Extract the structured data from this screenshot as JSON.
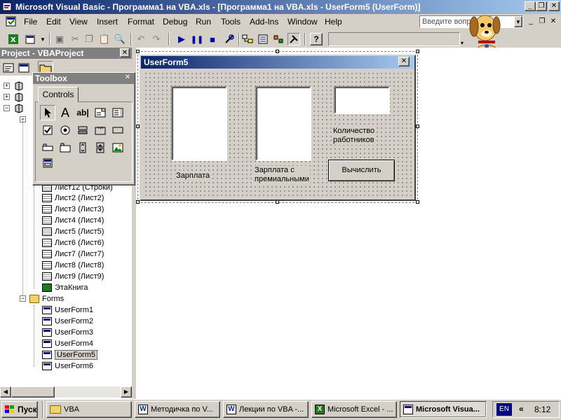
{
  "window": {
    "title": "Microsoft Visual Basic - Программа1 на VBA.xls - [Программа1 на VBA.xls - UserForm5 (UserForm)]"
  },
  "menu": [
    "File",
    "Edit",
    "View",
    "Insert",
    "Format",
    "Debug",
    "Run",
    "Tools",
    "Add-Ins",
    "Window",
    "Help"
  ],
  "help_search": {
    "placeholder": "Введите вопрос"
  },
  "project_panel": {
    "title": "Project - VBAProject",
    "items": [
      "Лист12 (Строки)",
      "Лист2 (Лист2)",
      "Лист3 (Лист3)",
      "Лист4 (Лист4)",
      "Лист5 (Лист5)",
      "Лист6 (Лист6)",
      "Лист7 (Лист7)",
      "Лист8 (Лист8)",
      "Лист9 (Лист9)",
      "ЭтаКнига"
    ],
    "forms_folder": "Forms",
    "forms": [
      "UserForm1",
      "UserForm2",
      "UserForm3",
      "UserForm4",
      "UserForm5",
      "UserForm6"
    ],
    "selected_form": "UserForm5"
  },
  "toolbox": {
    "title": "Toolbox",
    "tab": "Controls"
  },
  "userform": {
    "title": "UserForm5",
    "label_salary": "Зарплата",
    "label_salary_bonus_1": "Зарплата с",
    "label_salary_bonus_2": "премиальными",
    "label_workers_1": "Количество",
    "label_workers_2": "работников",
    "button_label": "Вычислить"
  },
  "taskbar": {
    "start": "Пуск",
    "tasks": [
      {
        "label": "VBA",
        "icon": "folder-icon",
        "active": false
      },
      {
        "label": "Методичка по V...",
        "icon": "word-icon",
        "active": false
      },
      {
        "label": "Лекции по VBA -...",
        "icon": "word-icon",
        "active": false
      },
      {
        "label": "Microsoft Excel - ...",
        "icon": "excel-icon",
        "active": false
      },
      {
        "label": "Microsoft Visua...",
        "icon": "vba-icon",
        "active": true
      }
    ],
    "language": "EN",
    "tray_arrow": "«",
    "clock": "8:12"
  },
  "colors": {
    "title_active": "#0a246a",
    "title_gradient_end": "#a6caf0",
    "panel_inactive": "#808080",
    "face": "#d4d0c8"
  }
}
